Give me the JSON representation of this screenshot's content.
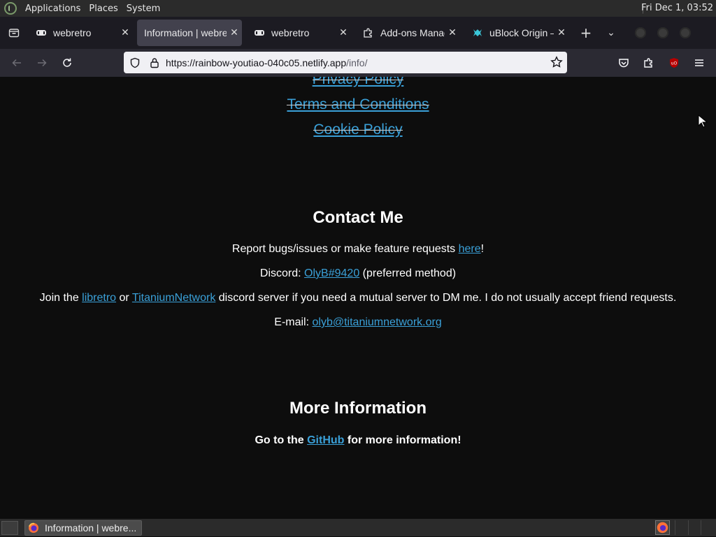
{
  "system_panel": {
    "menus": [
      "Applications",
      "Places",
      "System"
    ],
    "clock": "Fri Dec 1, 03:52"
  },
  "tabs": [
    {
      "title": "webretro",
      "active": false
    },
    {
      "title": "Information | webretro",
      "active": true
    },
    {
      "title": "webretro",
      "active": false
    },
    {
      "title": "Add-ons Manager",
      "active": false
    },
    {
      "title": "uBlock Origin — Dashboard",
      "active": false
    }
  ],
  "urlbar": {
    "host": "https://rainbow-youtiao-040c05.netlify.app",
    "path": "/info/"
  },
  "content": {
    "policies": [
      "Privacy Policy",
      "Terms and Conditions",
      "Cookie Policy"
    ],
    "contact": {
      "title": "Contact Me",
      "report_pre": "Report bugs/issues or make feature requests ",
      "report_link": "here",
      "report_post": "!",
      "discord_pre": "Discord: ",
      "discord_link": "OlyB#9420",
      "discord_post": " (preferred method)",
      "join_pre": "Join the ",
      "join_link1": "libretro",
      "join_mid": " or ",
      "join_link2": "TitaniumNetwork",
      "join_post": " discord server if you need a mutual server to DM me. I do not usually accept friend requests.",
      "email_pre": "E-mail: ",
      "email_link": "olyb@titaniumnetwork.org"
    },
    "more": {
      "title": "More Information",
      "pre": "Go to the ",
      "link": "GitHub",
      "post": " for more information!"
    }
  },
  "taskbar": {
    "window_title": "Information | webre..."
  },
  "colors": {
    "link": "#3aa0d8",
    "page_bg": "#0d0d0d",
    "tab_bar": "#1c1b22",
    "nav_bar": "#2b2a33"
  }
}
